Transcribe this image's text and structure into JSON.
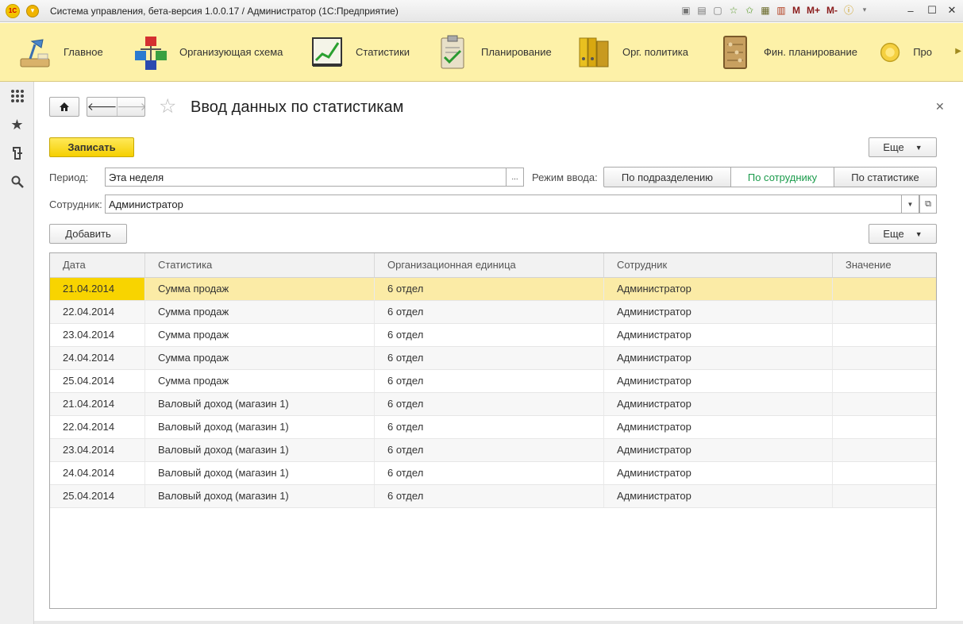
{
  "window": {
    "title": "Система управления, бета-версия 1.0.0.17 / Администратор  (1С:Предприятие)",
    "logo_text": "1С",
    "tools": [
      "M",
      "M+",
      "M-"
    ]
  },
  "sections": [
    {
      "label": "Главное",
      "icon": "desk-lamp-icon"
    },
    {
      "label": "Организующая схема",
      "icon": "org-chart-icon"
    },
    {
      "label": "Статистики",
      "icon": "line-graph-icon"
    },
    {
      "label": "Планирование",
      "icon": "clipboard-check-icon"
    },
    {
      "label": "Орг. политика",
      "icon": "binders-icon"
    },
    {
      "label": "Фин. планирование",
      "icon": "abacus-icon"
    },
    {
      "label": "Про",
      "icon": "disk-icon"
    }
  ],
  "form": {
    "title": "Ввод данных по статистикам",
    "save_label": "Записать",
    "more_label": "Еще",
    "period_label": "Период:",
    "period_value": "Эта неделя",
    "period_btn": "...",
    "mode_label": "Режим ввода:",
    "modes": [
      "По подразделению",
      "По сотруднику",
      "По статистике"
    ],
    "active_mode": "По сотруднику",
    "employee_label": "Сотрудник:",
    "employee_value": "Администратор",
    "add_label": "Добавить",
    "table_more_label": "Еще"
  },
  "table": {
    "columns": [
      "Дата",
      "Статистика",
      "Организационная единица",
      "Сотрудник",
      "Значение"
    ],
    "rows": [
      [
        "21.04.2014",
        "Сумма продаж",
        "6 отдел",
        "Администратор",
        ""
      ],
      [
        "22.04.2014",
        "Сумма продаж",
        "6 отдел",
        "Администратор",
        ""
      ],
      [
        "23.04.2014",
        "Сумма продаж",
        "6 отдел",
        "Администратор",
        ""
      ],
      [
        "24.04.2014",
        "Сумма продаж",
        "6 отдел",
        "Администратор",
        ""
      ],
      [
        "25.04.2014",
        "Сумма продаж",
        "6 отдел",
        "Администратор",
        ""
      ],
      [
        "21.04.2014",
        "Валовый доход (магазин 1)",
        "6 отдел",
        "Администратор",
        ""
      ],
      [
        "22.04.2014",
        "Валовый доход (магазин 1)",
        "6 отдел",
        "Администратор",
        ""
      ],
      [
        "23.04.2014",
        "Валовый доход (магазин 1)",
        "6 отдел",
        "Администратор",
        ""
      ],
      [
        "24.04.2014",
        "Валовый доход (магазин 1)",
        "6 отдел",
        "Администратор",
        ""
      ],
      [
        "25.04.2014",
        "Валовый доход (магазин 1)",
        "6 отдел",
        "Администратор",
        ""
      ]
    ],
    "selected_row": 0
  },
  "colors": {
    "accent_yellow": "#f8d400",
    "sections_bg": "#fdf1a8",
    "active_mode_text": "#1a9b4b"
  }
}
